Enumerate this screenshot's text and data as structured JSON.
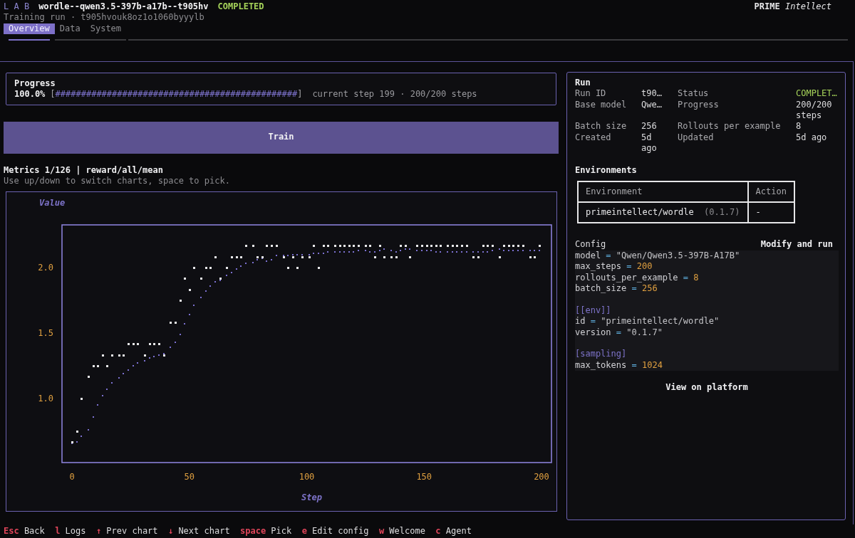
{
  "header": {
    "brand": "L A B",
    "run_name": "wordle--qwen3.5-397b-a17b--t905hv",
    "status": {
      "text": "COMPLETED",
      "kind": "completed"
    },
    "subtitle": "Training run · t905hvouk8oz1o1060byyylb",
    "logo": "**PRIME** *Intellect*"
  },
  "tabs": [
    {
      "label": "Overview",
      "selected": true
    },
    {
      "label": "Data",
      "selected": false
    },
    {
      "label": "System",
      "selected": false
    }
  ],
  "progress": {
    "title": "Progress",
    "percent": "100.0%",
    "bar_left": "[",
    "bar": "###############################################",
    "bar_right": "]",
    "detail": "current step 199 · 200/200 steps"
  },
  "train_button": "Train",
  "metrics": {
    "title": "Metrics 1/126 | reward/all/mean",
    "hint": "Use up/down to switch charts, space to pick.",
    "chart_data": {
      "type": "scatter",
      "xlabel": "Step",
      "ylabel": "Value",
      "xlim": [
        -4.25,
        204.25
      ],
      "ylim": [
        0.511,
        2.326
      ],
      "xticks": [
        0,
        50,
        100,
        150,
        200
      ],
      "yticks": [
        {
          "value": 1,
          "label": "1.0"
        },
        {
          "value": 1.5,
          "label": "1.5"
        },
        {
          "value": 2,
          "label": "2.0"
        }
      ],
      "x": [
        0,
        2,
        4,
        7,
        9,
        11,
        13,
        15,
        17,
        20,
        22,
        24,
        26,
        28,
        31,
        33,
        35,
        37,
        39,
        42,
        44,
        46,
        48,
        50,
        52,
        55,
        57,
        59,
        61,
        63,
        66,
        68,
        70,
        72,
        74,
        77,
        79,
        81,
        83,
        85,
        87,
        90,
        92,
        94,
        96,
        98,
        101,
        103,
        105,
        107,
        109,
        112,
        114,
        116,
        118,
        120,
        122,
        125,
        127,
        129,
        131,
        133,
        136,
        138,
        140,
        142,
        144,
        147,
        149,
        151,
        153,
        155,
        157,
        160,
        162,
        164,
        166,
        168,
        171,
        173,
        175,
        177,
        179,
        182,
        184,
        186,
        188,
        190,
        192,
        195,
        197,
        199
      ],
      "series": [
        {
          "color": "#e8e8ea",
          "values": [
            0.667,
            0.75,
            1.0,
            1.167,
            1.25,
            1.25,
            1.333,
            1.25,
            1.333,
            1.333,
            1.333,
            1.417,
            1.417,
            1.417,
            1.333,
            1.417,
            1.417,
            1.417,
            1.333,
            1.583,
            1.583,
            1.75,
            1.917,
            1.833,
            2.0,
            1.917,
            2.0,
            2.0,
            2.083,
            1.917,
            2.0,
            2.083,
            2.083,
            2.083,
            2.167,
            2.167,
            2.083,
            2.083,
            2.167,
            2.167,
            2.167,
            2.083,
            2.0,
            2.083,
            2.0,
            2.083,
            2.083,
            2.167,
            2.0,
            2.167,
            2.167,
            2.167,
            2.167,
            2.167,
            2.167,
            2.167,
            2.167,
            2.167,
            2.167,
            2.083,
            2.167,
            2.083,
            2.083,
            2.083,
            2.167,
            2.167,
            2.083,
            2.167,
            2.167,
            2.167,
            2.167,
            2.167,
            2.167,
            2.167,
            2.167,
            2.167,
            2.167,
            2.167,
            2.083,
            2.083,
            2.167,
            2.167,
            2.167,
            2.083,
            2.167,
            2.167,
            2.167,
            2.167,
            2.167,
            2.083,
            2.083,
            2.167
          ]
        },
        {
          "color": "#7b70d0",
          "values": [
            0.66,
            0.67,
            0.71,
            0.76,
            0.86,
            0.95,
            1.02,
            1.07,
            1.12,
            1.16,
            1.19,
            1.22,
            1.25,
            1.27,
            1.29,
            1.31,
            1.32,
            1.33,
            1.34,
            1.39,
            1.43,
            1.49,
            1.57,
            1.64,
            1.71,
            1.77,
            1.82,
            1.86,
            1.89,
            1.9,
            1.94,
            1.96,
            1.99,
            2.01,
            2.03,
            2.04,
            2.06,
            2.07,
            2.05,
            2.06,
            2.09,
            2.09,
            2.09,
            2.1,
            2.1,
            2.1,
            2.1,
            2.11,
            2.11,
            2.11,
            2.12,
            2.12,
            2.12,
            2.12,
            2.12,
            2.12,
            2.13,
            2.13,
            2.12,
            2.12,
            2.13,
            2.14,
            2.13,
            2.12,
            2.13,
            2.14,
            2.14,
            2.13,
            2.13,
            2.13,
            2.13,
            2.12,
            2.12,
            2.12,
            2.12,
            2.12,
            2.12,
            2.12,
            2.12,
            2.12,
            2.12,
            2.12,
            2.13,
            2.14,
            2.13,
            2.13,
            2.13,
            2.13,
            2.13,
            2.13,
            2.13,
            2.13
          ]
        }
      ]
    }
  },
  "run": {
    "title": "Run",
    "rows": [
      [
        {
          "label": "Run ID",
          "value": "t90…",
          "kind": "plain"
        },
        {
          "label": "Status",
          "value": "COMPLET…",
          "kind": "status"
        }
      ],
      [
        {
          "label": "Base model",
          "value": "Qwe…",
          "kind": "plain"
        },
        {
          "label": "Progress",
          "value": "200/200 steps",
          "kind": "plain"
        }
      ],
      [
        {
          "label": "Batch size",
          "value": "256",
          "kind": "plain"
        },
        {
          "label": "Rollouts per example",
          "value": "8",
          "kind": "plain"
        }
      ],
      [
        {
          "label": "Created",
          "value": "5d ago",
          "kind": "plain"
        },
        {
          "label": "Updated",
          "value": "5d ago",
          "kind": "plain"
        }
      ]
    ]
  },
  "environments": {
    "title": "Environments",
    "columns": [
      "Environment",
      "Action"
    ],
    "rows": [
      {
        "name": "primeintellect/wordle",
        "version": "(0.1.7)",
        "action": "-"
      }
    ]
  },
  "config": {
    "title": "Config",
    "action": "Modify and run",
    "lines": [
      {
        "kind": "string",
        "key": "model",
        "op": "=",
        "value": "\"Qwen/Qwen3.5-397B-A17B\""
      },
      {
        "kind": "number",
        "key": "max_steps",
        "op": "=",
        "value": "200"
      },
      {
        "kind": "number",
        "key": "rollouts_per_example",
        "op": "=",
        "value": "8"
      },
      {
        "kind": "number",
        "key": "batch_size",
        "op": "=",
        "value": "256"
      },
      {
        "kind": "blank"
      },
      {
        "kind": "section",
        "text": "[[env]]"
      },
      {
        "kind": "string",
        "key": "id",
        "op": "=",
        "value": "\"primeintellect/wordle\""
      },
      {
        "kind": "string",
        "key": "version",
        "op": "=",
        "value": "\"0.1.7\""
      },
      {
        "kind": "blank"
      },
      {
        "kind": "section",
        "text": "[sampling]"
      },
      {
        "kind": "number",
        "key": "max_tokens",
        "op": "=",
        "value": "1024"
      }
    ]
  },
  "platform_link": "View on platform",
  "shortcuts": [
    {
      "key": "Esc",
      "label": "Back"
    },
    {
      "key": "l",
      "label": "Logs"
    },
    {
      "key": "↑",
      "label": "Prev chart"
    },
    {
      "key": "↓",
      "label": "Next chart"
    },
    {
      "key": "space",
      "label": "Pick"
    },
    {
      "key": "e",
      "label": "Edit config"
    },
    {
      "key": "w",
      "label": "Welcome"
    },
    {
      "key": "c",
      "label": "Agent"
    }
  ]
}
